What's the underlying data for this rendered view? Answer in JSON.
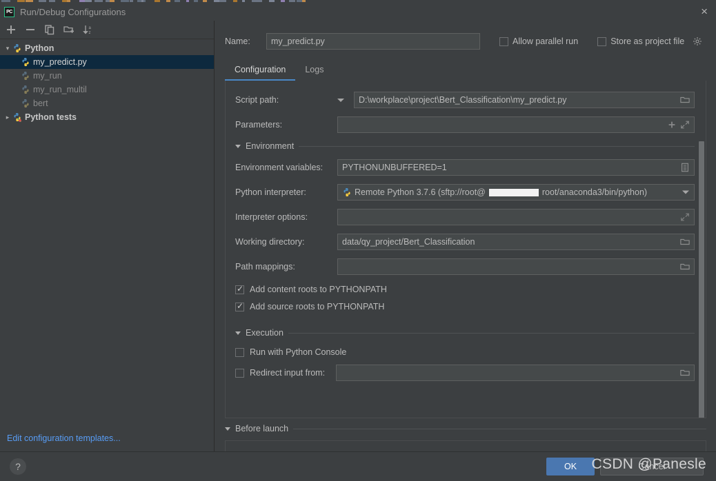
{
  "window": {
    "title": "Run/Debug Configurations",
    "app_logo": "pycharm-logo",
    "close_label": "×"
  },
  "left_panel": {
    "toolbar": [
      {
        "name": "add-configuration-button",
        "icon": "plus-icon",
        "label": "+"
      },
      {
        "name": "remove-configuration-button",
        "icon": "minus-icon",
        "label": "−"
      },
      {
        "name": "copy-configuration-button",
        "icon": "copy-icon",
        "label": "Copy"
      },
      {
        "name": "save-configuration-button",
        "icon": "folder-add-icon",
        "label": "Save configuration"
      },
      {
        "name": "sort-configurations-button",
        "icon": "sort-alphabetically-icon",
        "label": "Sort"
      }
    ],
    "tree": [
      {
        "label": "Python",
        "type": "group",
        "expanded": true,
        "icon": "python-icon",
        "arrow": "⌄"
      },
      {
        "label": "my_predict.py",
        "type": "item",
        "selected": true,
        "icon": "python-icon"
      },
      {
        "label": "my_run",
        "type": "item",
        "selected": false,
        "icon": "python-icon"
      },
      {
        "label": "my_run_multil",
        "type": "item",
        "selected": false,
        "icon": "python-icon"
      },
      {
        "label": "bert",
        "type": "item",
        "selected": false,
        "icon": "python-icon"
      },
      {
        "label": "Python tests",
        "type": "group",
        "expanded": false,
        "icon": "python-tests-icon",
        "arrow": "›"
      }
    ],
    "edit_templates_link": "Edit configuration templates..."
  },
  "header": {
    "name_label": "Name:",
    "name_value": "my_predict.py",
    "name_placeholder": "",
    "allow_parallel_run": {
      "label": "Allow parallel run",
      "checked": false
    },
    "store_as_project_file": {
      "label": "Store as project file",
      "checked": false,
      "gear_icon": "gear-icon"
    }
  },
  "tabs": [
    {
      "label": "Configuration",
      "active": true
    },
    {
      "label": "Logs",
      "active": false
    }
  ],
  "configuration": {
    "script_path": {
      "label": "Script path:",
      "value": "D:\\workplace\\project\\Bert_Classification\\my_predict.py",
      "dropdown_icon": "chevron-down-icon",
      "browse_icon": "folder-icon"
    },
    "parameters": {
      "label": "Parameters:",
      "value": "",
      "insert_icon": "plus-icon",
      "expand_icon": "expand-icon"
    },
    "environment_section": {
      "label": "Environment",
      "expanded": true,
      "environment_variables": {
        "label": "Environment variables:",
        "value": "PYTHONUNBUFFERED=1",
        "browse_icon": "list-edit-icon"
      },
      "python_interpreter": {
        "label": "Python interpreter:",
        "value_prefix": "Remote Python 3.7.6 (sftp://root@",
        "value_redacted": true,
        "value_suffix": "root/anaconda3/bin/python)",
        "icon": "remote-python-icon",
        "dropdown_icon": "chevron-down-icon"
      },
      "interpreter_options": {
        "label": "Interpreter options:",
        "value": "",
        "expand_icon": "expand-icon"
      },
      "working_directory": {
        "label": "Working directory:",
        "value": "data/qy_project/Bert_Classification",
        "browse_icon": "folder-icon"
      },
      "path_mappings": {
        "label": "Path mappings:",
        "value": "",
        "browse_icon": "folder-icon"
      },
      "add_content_roots": {
        "label": "Add content roots to PYTHONPATH",
        "checked": true
      },
      "add_source_roots": {
        "label": "Add source roots to PYTHONPATH",
        "checked": true
      }
    },
    "execution_section": {
      "label": "Execution",
      "expanded": true,
      "run_with_python_console": {
        "label": "Run with Python Console",
        "checked": false
      },
      "redirect_input_from": {
        "label": "Redirect input from:",
        "checked": false,
        "value": "",
        "browse_icon": "folder-icon"
      }
    }
  },
  "before_launch": {
    "label": "Before launch",
    "expanded": true,
    "toolbar": [
      {
        "name": "add-task-button",
        "icon": "plus-icon",
        "enabled": true
      },
      {
        "name": "remove-task-button",
        "icon": "minus-icon",
        "enabled": false
      },
      {
        "name": "edit-task-button",
        "icon": "pencil-icon",
        "enabled": false
      },
      {
        "name": "move-up-button",
        "icon": "arrow-up-icon",
        "enabled": false
      },
      {
        "name": "move-down-button",
        "icon": "arrow-down-icon",
        "enabled": false
      }
    ]
  },
  "footer": {
    "help_label": "?",
    "ok_label": "OK",
    "cancel_label": "Cancel",
    "watermark": "CSDN @Panesle"
  },
  "colors": {
    "dialog_bg": "#3c3f41",
    "field_bg": "#45494a",
    "selection_bg": "#0d293e",
    "accent_blue": "#4a88c7",
    "link_blue": "#589df6",
    "ok_button": "#4a77b0"
  }
}
